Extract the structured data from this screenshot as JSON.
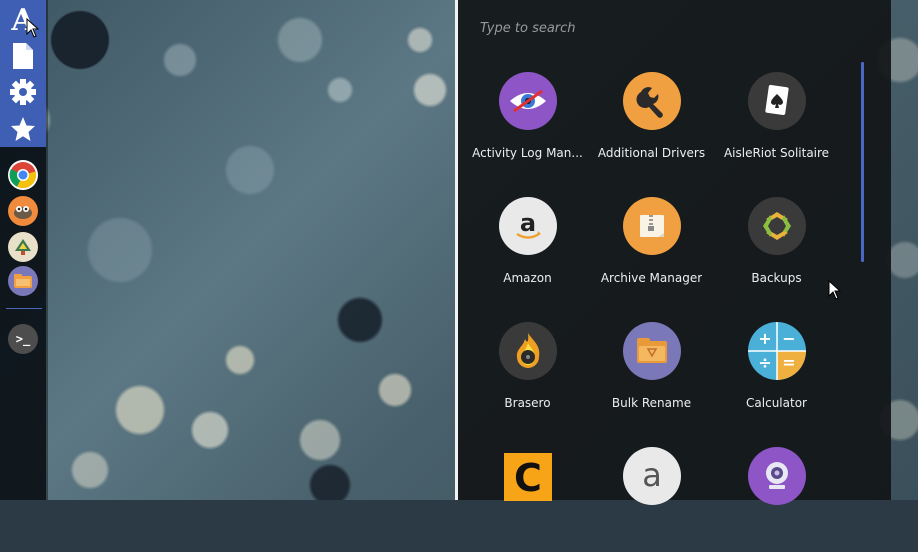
{
  "launcher": {
    "search_placeholder": "Type to search",
    "apps": [
      {
        "label": "Activity Log Man...",
        "icon": "activity-log-eye-icon",
        "color": "#8e55c6"
      },
      {
        "label": "Additional Drivers",
        "icon": "wrench-icon",
        "color": "#f0a040"
      },
      {
        "label": "AisleRiot Solitaire",
        "icon": "spade-card-icon",
        "color": "#3a3a3a"
      },
      {
        "label": "Amazon",
        "icon": "amazon-icon",
        "color": "#e9e9e9"
      },
      {
        "label": "Archive Manager",
        "icon": "archive-icon",
        "color": "#f0a040"
      },
      {
        "label": "Backups",
        "icon": "backups-icon",
        "color": "#3a3a3a"
      },
      {
        "label": "Brasero",
        "icon": "brasero-flame-icon",
        "color": "#3a3a3a"
      },
      {
        "label": "Bulk Rename",
        "icon": "folder-icon",
        "color": "#7a78b8"
      },
      {
        "label": "Calculator",
        "icon": "calculator-icon",
        "color": "#4ab0d8"
      }
    ]
  },
  "dock": {
    "items": [
      {
        "name": "apps-menu-icon",
        "glyph": "A"
      },
      {
        "name": "file-icon"
      },
      {
        "name": "settings-gear-icon"
      },
      {
        "name": "favorites-star-icon"
      },
      {
        "name": "chrome-icon"
      },
      {
        "name": "gimp-icon"
      },
      {
        "name": "inkscape-icon"
      },
      {
        "name": "archive-app-icon"
      },
      {
        "name": "terminal-icon"
      }
    ]
  },
  "colors": {
    "dock_accent": "#3f5fb4",
    "panel_bg": "#121618",
    "scrollbar": "#4a68c2"
  }
}
